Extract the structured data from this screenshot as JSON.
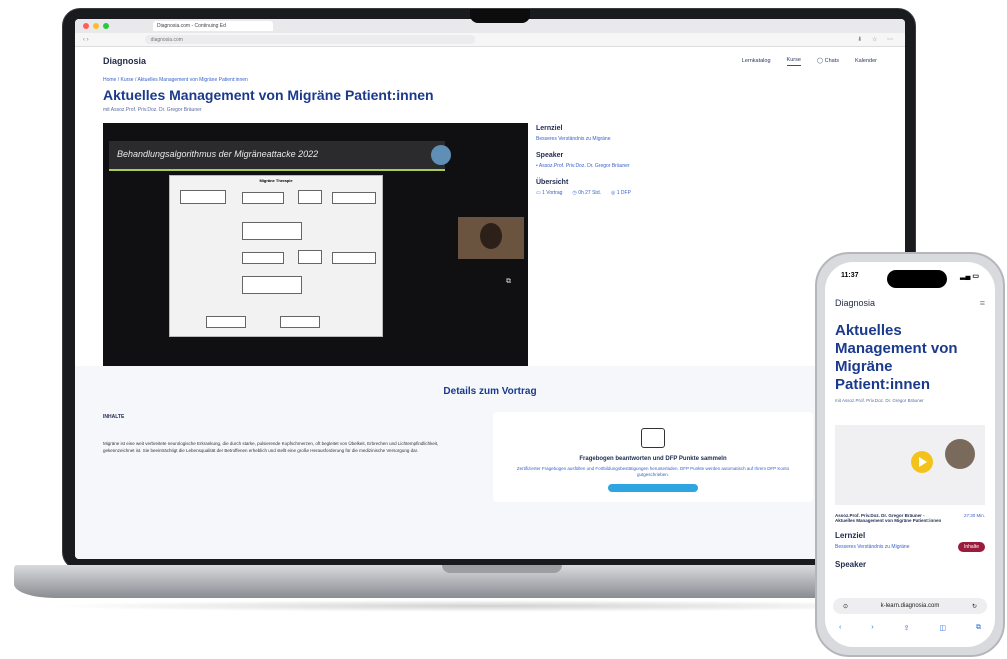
{
  "laptop": {
    "browser": {
      "tab_title": "Diagnosia.com - Continuing Ed",
      "url": "diagnosia.com"
    },
    "site": {
      "logo": "Diagnosia",
      "nav": [
        "Lernkatalog",
        "Kurse",
        "Chats",
        "Kalender"
      ],
      "breadcrumb": "Home / Kurse / Aktuelles Management von Migräne Patient:innen",
      "title": "Aktuelles Management von Migräne Patient:innen",
      "byline": "mit Assoz.Prof. Priv.Doz. Dr. Gregor Bräuner"
    },
    "video": {
      "slide_title": "Behandlungsalgorithmus der Migräneattacke 2022",
      "flow_title": "Migräne Therapie"
    },
    "side": {
      "goal_heading": "Lernziel",
      "goal_text": "Besseres Verständnis zu Migräne",
      "speaker_heading": "Speaker",
      "speaker_name": "• Assoz.Prof. Priv.Doz. Dr. Gregor Bräuner",
      "overview_heading": "Übersicht",
      "overview": [
        "1 Vortrag",
        "0h 27 Std.",
        "1 DFP"
      ]
    },
    "details": {
      "heading": "Details zum Vortrag",
      "inhalt_label": "INHALTE",
      "inhalt_text": "Migräne ist eine weit verbreitete neurologische Erkrankung, die durch starke, pulsierende Kopfschmerzen, oft begleitet von Übelkeit, Erbrechen und Lichtempfindlichkeit, gekennzeichnet ist. Sie beeinträchtigt die Lebensqualität der Betroffenen erheblich und stellt eine große Herausforderung für die medizinische Versorgung dar.",
      "card_title": "Fragebogen beantworten und DFP Punkte sammeln",
      "card_text": "Zertifizierter Fragebogen ausfüllen und Fortbildungsbestätigungen herunterladen. DFP Punkte werden automatisch auf Ihrem DFP Konto gutgeschrieben."
    }
  },
  "phone": {
    "time": "11:37",
    "logo": "Diagnosia",
    "title": "Aktuelles Management von Migräne Patient:innen",
    "byline": "mit Assoz.Prof. Priv.Doz. Dr. Gregor Bräuner",
    "video_caption": "Assoz.Prof. Priv.Doz. Dr. Gregor Bräuner - Aktuelles Management von Migräne Patient:innen",
    "duration": "27:30 Min.",
    "goal_heading": "Lernziel",
    "goal_text": "Besseres Verständnis zu Migräne",
    "pill": "Inhalte",
    "speaker_heading": "Speaker",
    "address": "k-learn.diagnosia.com"
  }
}
